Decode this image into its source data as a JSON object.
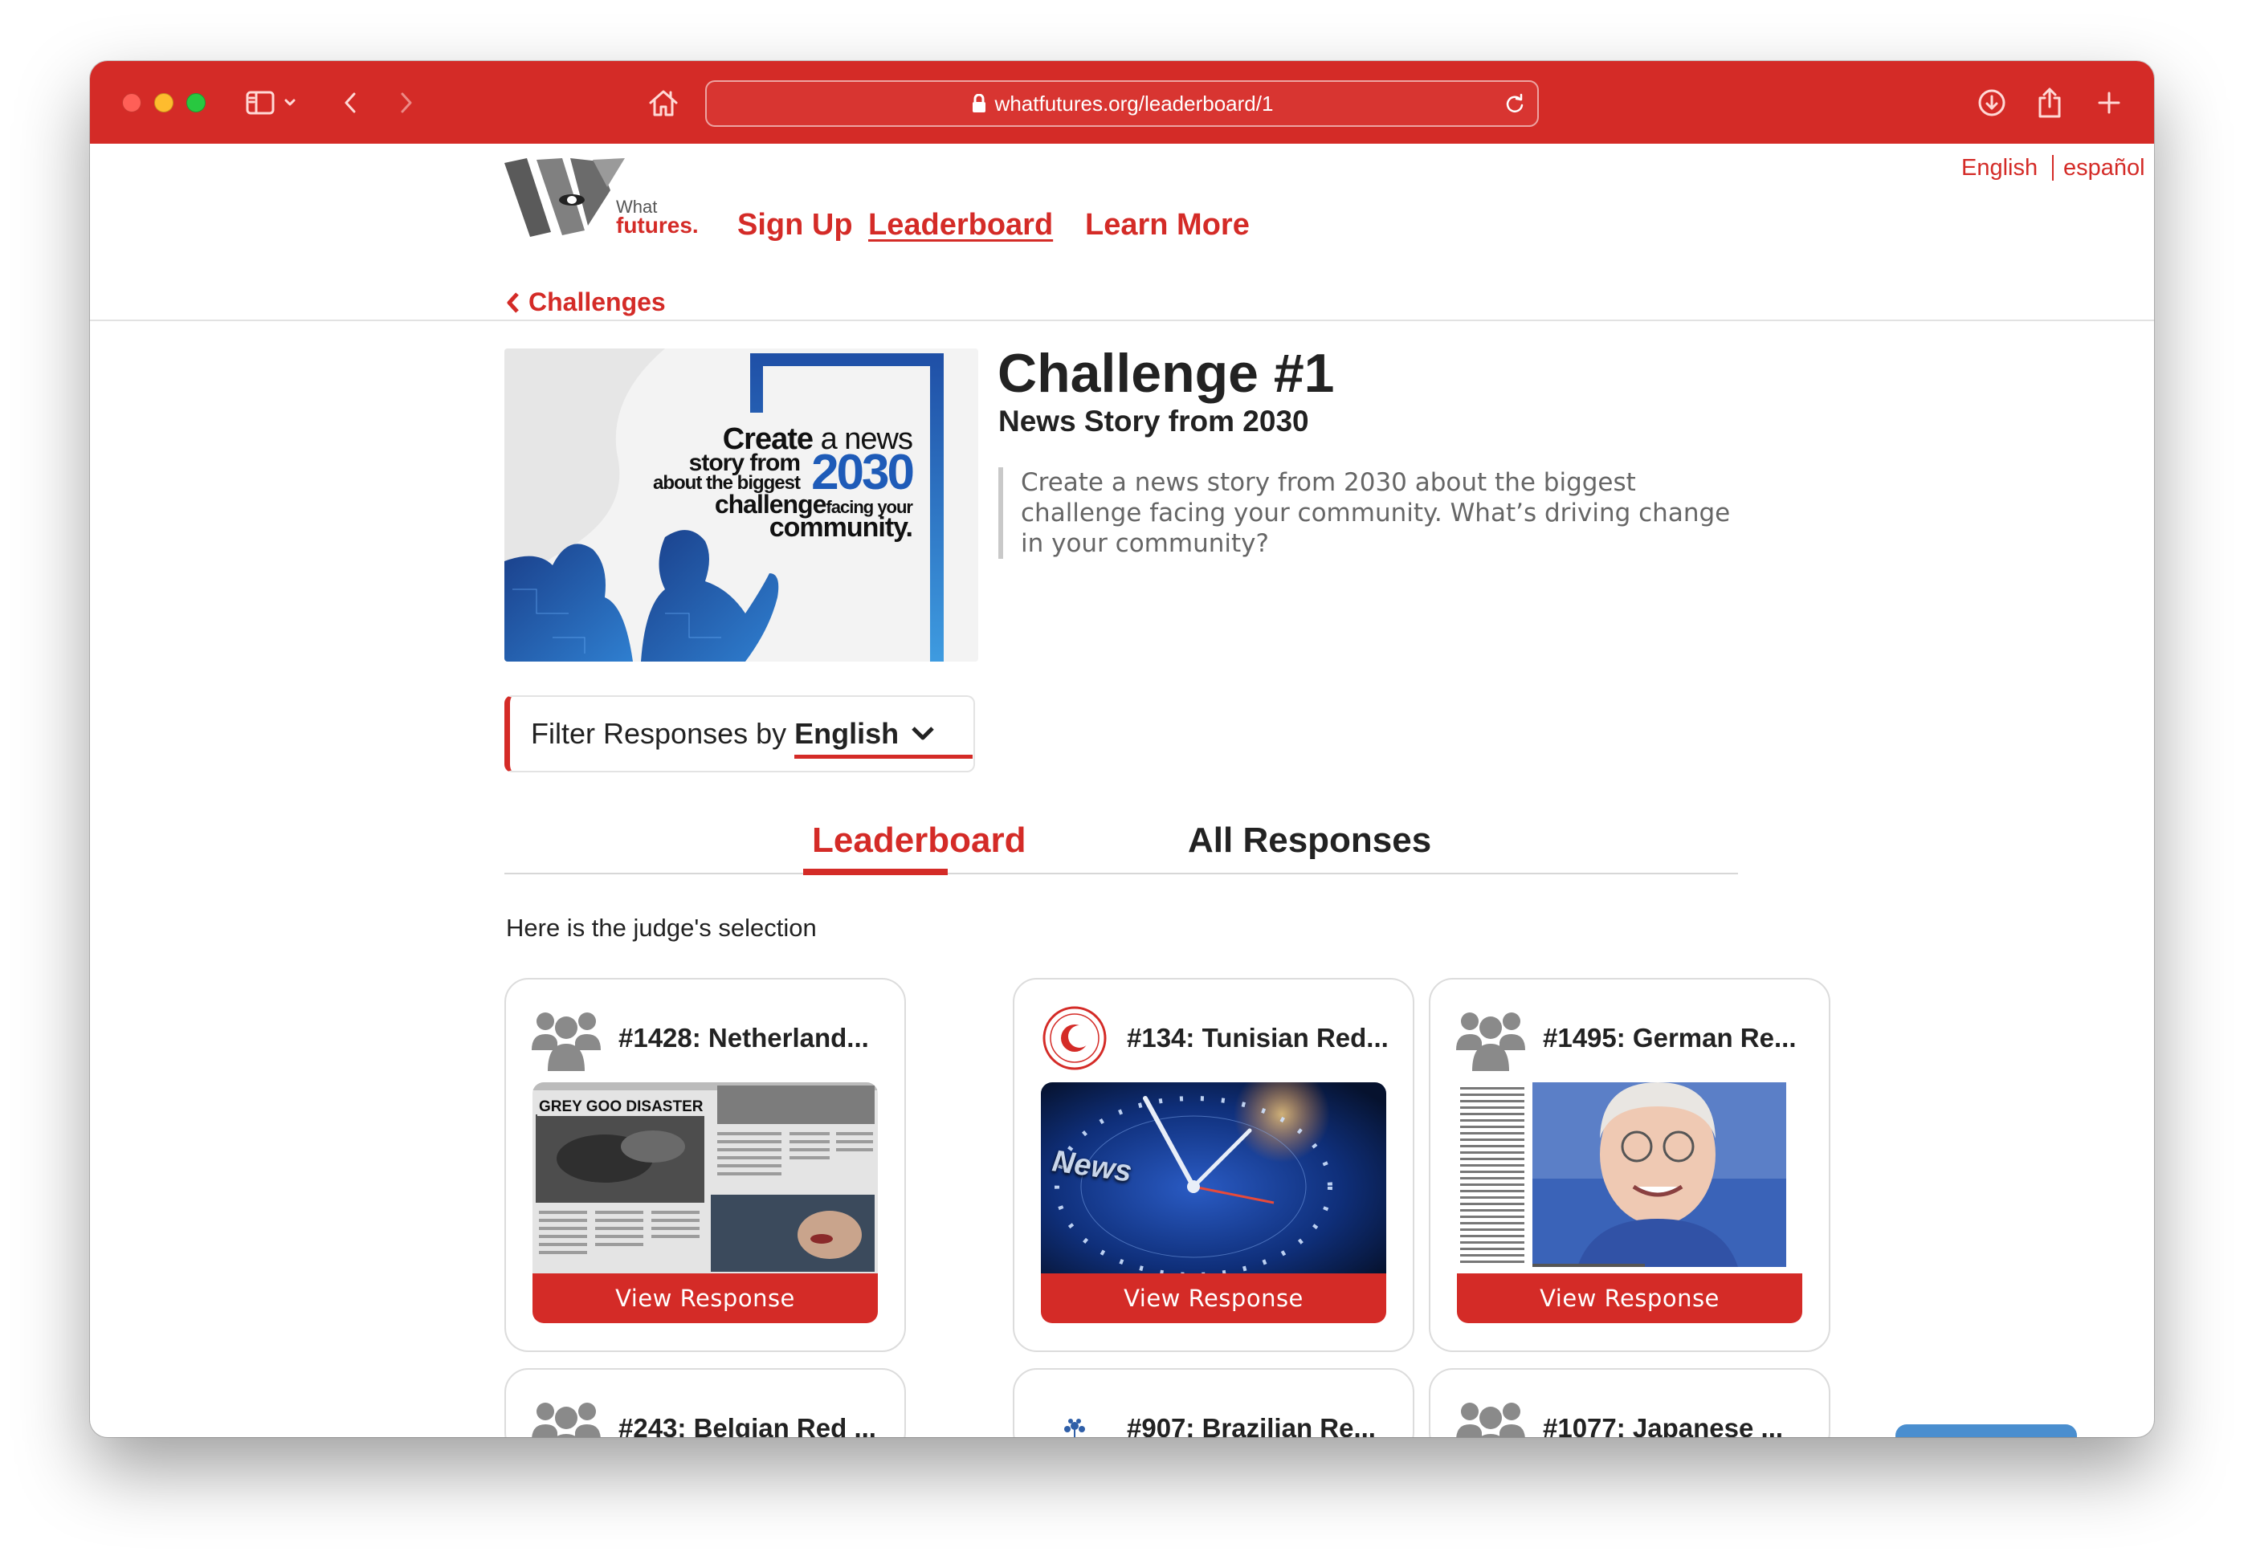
{
  "browser": {
    "url": "whatfutures.org/leaderboard/1"
  },
  "site": {
    "logo_small": "What",
    "logo_big": "futures.",
    "nav": {
      "signup": "Sign Up",
      "leaderboard": "Leaderboard",
      "learn_more": "Learn More"
    },
    "languages": [
      "English",
      "español"
    ]
  },
  "back_link": "Challenges",
  "hero": {
    "line1a": "Create",
    "line1b": " a news",
    "line2": "story from",
    "line3": "about the biggest",
    "year": "2030",
    "line4a": "challenge",
    "line4b": "facing your",
    "line5": "community."
  },
  "challenge": {
    "title": "Challenge #1",
    "subtitle": "News Story from 2030",
    "description": "Create a news story from 2030 about the biggest challenge facing your community. What’s driving change in your community?"
  },
  "filter": {
    "prefix": "Filter Responses by",
    "language": "English"
  },
  "tabs": {
    "leaderboard": "Leaderboard",
    "all": "All Responses"
  },
  "judge_text": "Here is the judge's selection",
  "cards": [
    {
      "title": "#1428: Netherland...",
      "button": "View Response",
      "thumb_headline": "GREY GOO DISASTER"
    },
    {
      "title": "#134: Tunisian Red...",
      "button": "View Response",
      "thumb_word": "News"
    },
    {
      "title": "#1495: German Re...",
      "button": "View Response"
    },
    {
      "title": "#243: Belgian Red ..."
    },
    {
      "title": "#907: Brazilian Re..."
    },
    {
      "title": "#1077: Japanese ..."
    }
  ]
}
